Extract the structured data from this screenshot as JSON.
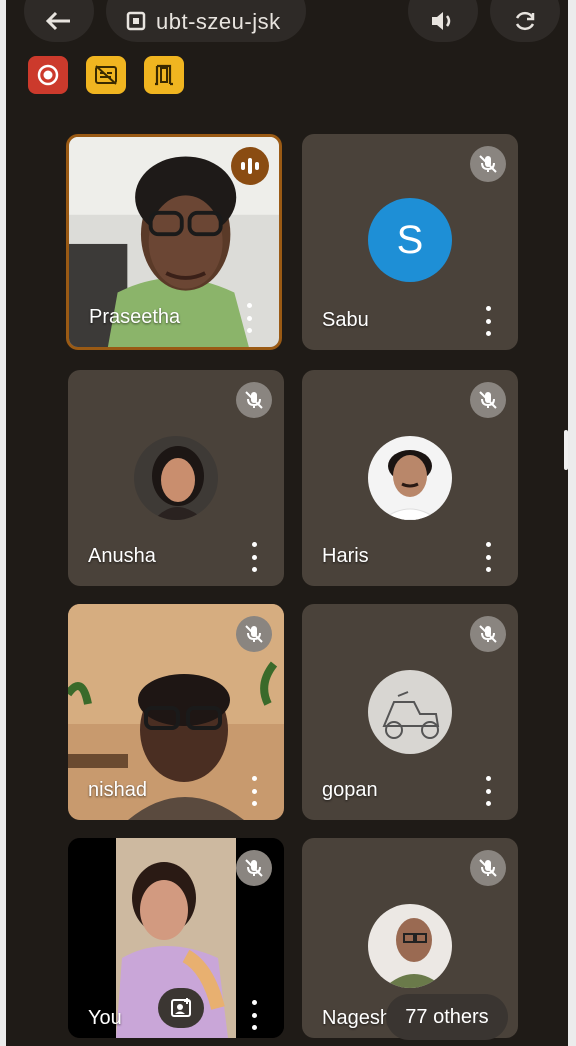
{
  "meeting": {
    "code": "ubt-szeu-jsk"
  },
  "status_icons": [
    "record-icon",
    "captions-off-icon",
    "door-exit-icon"
  ],
  "participants": [
    {
      "name": "Praseetha",
      "speaking": true,
      "muted": false,
      "type": "video"
    },
    {
      "name": "Sabu",
      "muted": true,
      "type": "letter",
      "initial": "S",
      "avatar_color": "#1e8fd6"
    },
    {
      "name": "Anusha",
      "muted": true,
      "type": "photo"
    },
    {
      "name": "Haris",
      "muted": true,
      "type": "photo"
    },
    {
      "name": "nishad",
      "muted": true,
      "type": "video"
    },
    {
      "name": "gopan",
      "muted": true,
      "type": "photo"
    },
    {
      "name": "You",
      "muted": true,
      "type": "video"
    },
    {
      "name": "Nagesh",
      "muted": true,
      "type": "photo"
    }
  ],
  "others": {
    "label": "77 others"
  },
  "colors": {
    "background": "#1f1b17",
    "tile": "#4a423a",
    "active_border": "#9a5a14",
    "record": "#cc3a2c",
    "yellow": "#f0b520"
  }
}
